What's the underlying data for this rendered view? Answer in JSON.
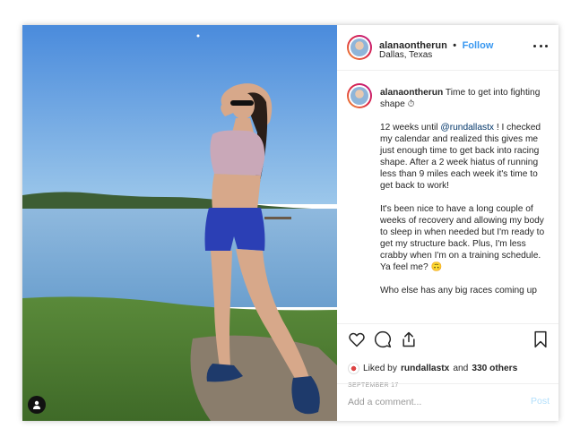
{
  "post": {
    "username": "alanaontherun",
    "separator": "•",
    "follow_label": "Follow",
    "location": "Dallas, Texas"
  },
  "caption": {
    "username": "alanaontherun",
    "line1": "Time to get into fighting shape ⏱",
    "p2_before": "12 weeks until ",
    "p2_mention": "@rundallastx",
    "p2_after": " ! I checked my calendar and realized this gives me just enough time to get back into racing shape. After a 2 week hiatus of running less than 9 miles each week it's time to get back to work!",
    "p3": "It's been nice to have a long couple of weeks of recovery and allowing my body to sleep in when needed but I'm ready to get my structure back. Plus, I'm less crabby when I'm on a training schedule. Ya feel me? 🙃",
    "p4": "Who else has any big races coming up"
  },
  "likes": {
    "prefix": "Liked by",
    "user": "rundallastx",
    "and": "and",
    "others": "330 others"
  },
  "date": "SEPTEMBER 17",
  "comment": {
    "placeholder": "Add a comment...",
    "post_label": "Post"
  },
  "icons": {
    "like": "heart-icon",
    "comment": "comment-icon",
    "share": "share-icon",
    "save": "bookmark-icon",
    "more": "more-options-icon",
    "tag": "user-tag-icon"
  },
  "colors": {
    "link": "#3897f0",
    "mention": "#003569",
    "post_disabled": "#b2dffc"
  }
}
